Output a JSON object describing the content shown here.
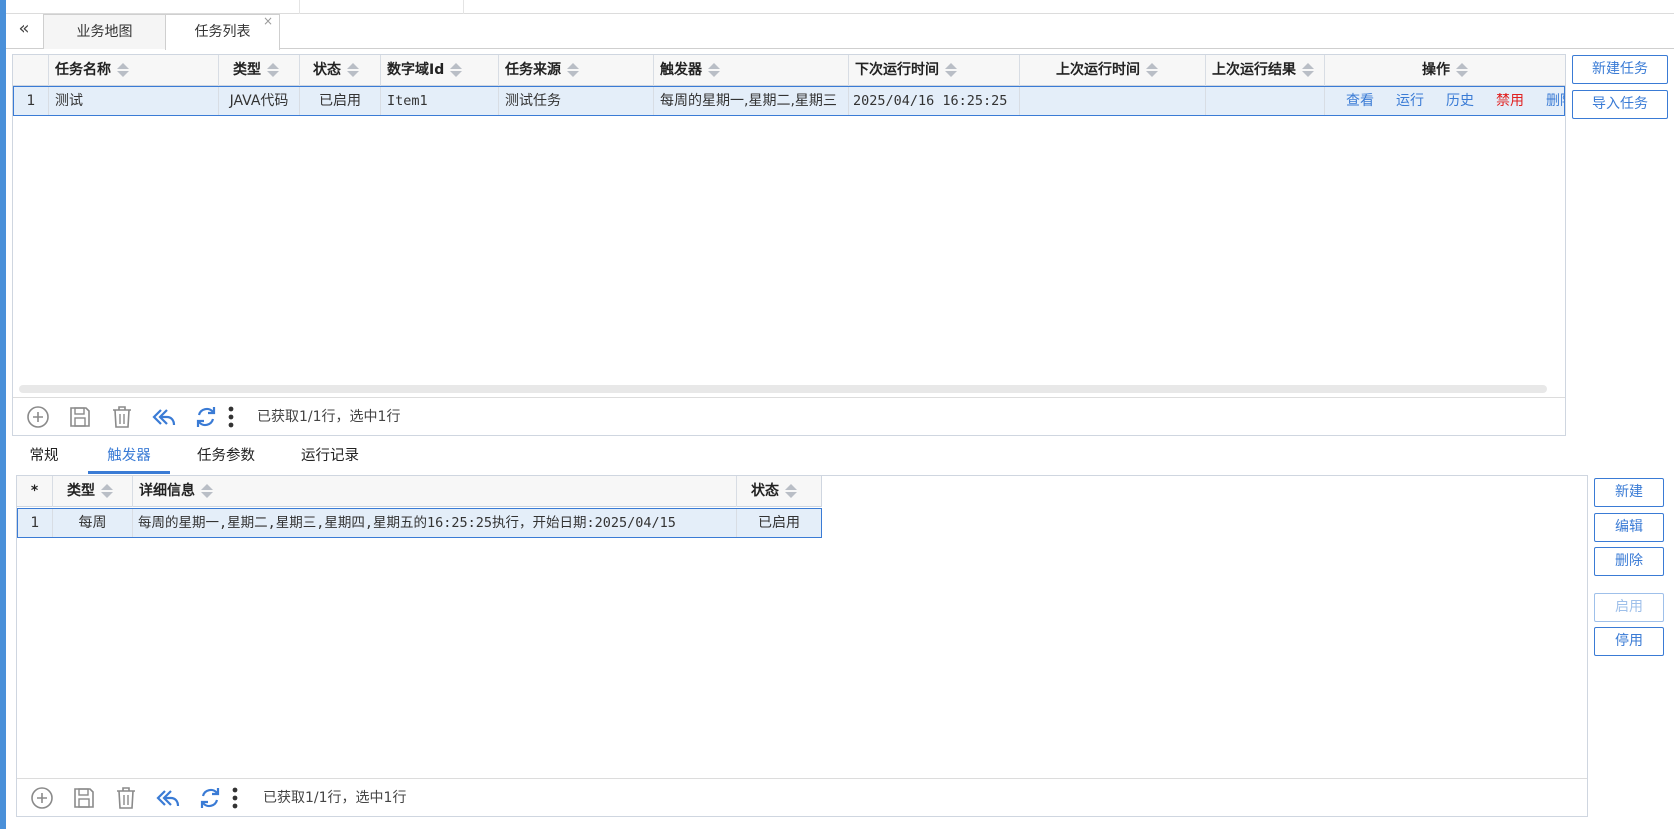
{
  "tabs": [
    {
      "label": "业务地图"
    },
    {
      "label": "任务列表",
      "close": "×"
    }
  ],
  "collapse_glyph": "«",
  "task_grid": {
    "columns": [
      "任务名称",
      "类型",
      "状态",
      "数字域Id",
      "任务来源",
      "触发器",
      "下次运行时间",
      "上次运行时间",
      "上次运行结果",
      "操作"
    ],
    "rows": [
      {
        "index": "1",
        "name": "测试",
        "type": "JAVA代码",
        "status": "已启用",
        "domain_id": "Item1",
        "source": "测试任务",
        "trigger": "每周的星期一,星期二,星期三",
        "next_run": "2025/04/16 16:25:25",
        "last_run": "",
        "last_result": "",
        "ops": [
          "查看",
          "运行",
          "历史",
          "禁用",
          "删除"
        ]
      }
    ],
    "status_text": "已获取1/1行，选中1行"
  },
  "task_buttons": {
    "new": "新建任务",
    "import": "导入任务"
  },
  "sub_tabs": [
    "常规",
    "触发器",
    "任务参数",
    "运行记录"
  ],
  "active_sub_tab": "触发器",
  "trigger_grid": {
    "columns": [
      "*",
      "类型",
      "详细信息",
      "状态"
    ],
    "rows": [
      {
        "index": "1",
        "type": "每周",
        "detail": "每周的星期一,星期二,星期三,星期四,星期五的16:25:25执行，开始日期:2025/04/15",
        "status": "已启用"
      }
    ],
    "status_text": "已获取1/1行，选中1行"
  },
  "trigger_buttons": {
    "new": "新建",
    "edit": "编辑",
    "delete": "删除",
    "enable": "启用",
    "disable": "停用"
  },
  "colors": {
    "accent": "#3a7bd5",
    "danger": "#e02020",
    "selected_row": "#e4eef9"
  }
}
